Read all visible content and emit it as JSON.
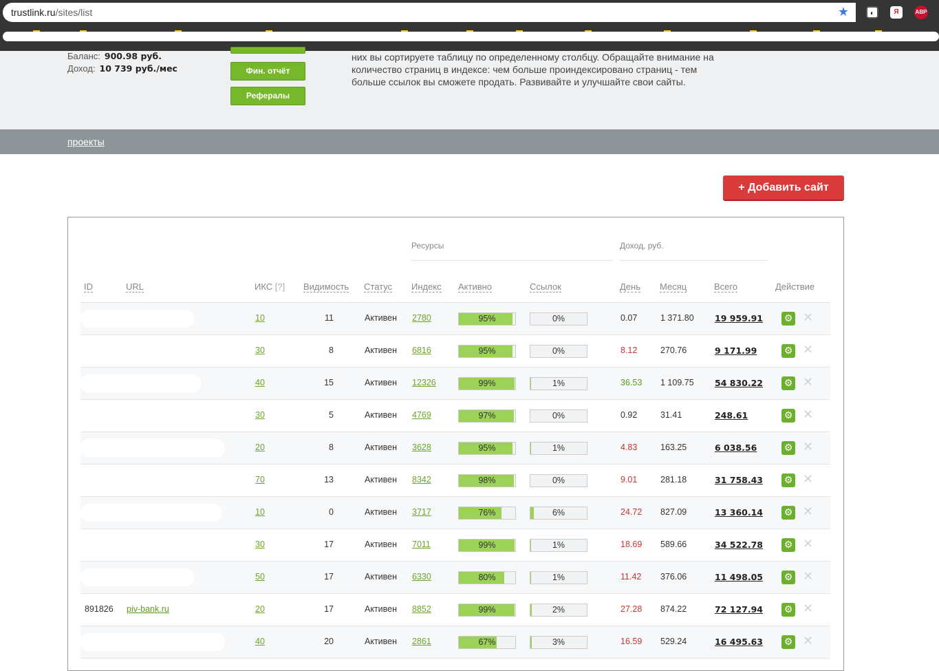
{
  "browser": {
    "url_host": "trustlink.ru",
    "url_path": "/sites/list"
  },
  "account": {
    "balance_label": "Баланс:",
    "balance_value": "900.98  руб.",
    "income_label": "Доход:",
    "income_value": "10 739 руб./мес"
  },
  "buttons": {
    "fin_report": "Фин. отчёт",
    "referrals": "Рефералы",
    "add_site": "+ Добавить сайт"
  },
  "info_text": "них вы сортируете таблицу по определенному столбцу. Обращайте внимание на количество страниц в индексе: чем больше проиндексировано страниц - тем больше ссылок вы сможете продать. Развивайте и улучшайте свои сайты.",
  "nav": {
    "projects": "проекты"
  },
  "table": {
    "group_resources": "Ресурсы",
    "group_income": "Доход,  руб.",
    "headers": {
      "id": "ID",
      "url": "URL",
      "iks": "ИКС",
      "iks_q": "[?]",
      "visibility": "Видимость",
      "status": "Статус",
      "index": "Индекс",
      "active": "Активно",
      "links": "Ссылок",
      "day": "День",
      "month": "Месяц",
      "total": "Всего",
      "action": "Действие"
    },
    "rows": [
      {
        "id": "",
        "url": "",
        "iks": "10",
        "vis": "11",
        "status": "Активен",
        "index": "2780",
        "active": 95,
        "active_lbl": "95%",
        "links": 0,
        "links_lbl": "0%",
        "day": "0.07",
        "day_color": "normal",
        "month": "1 371.80",
        "total": "19 959.91"
      },
      {
        "id": "",
        "url": "",
        "iks": "30",
        "vis": "8",
        "status": "Активен",
        "index": "6816",
        "active": 95,
        "active_lbl": "95%",
        "links": 0,
        "links_lbl": "0%",
        "day": "8.12",
        "day_color": "red",
        "month": "270.76",
        "total": "9 171.99"
      },
      {
        "id": "",
        "url": "",
        "iks": "40",
        "vis": "15",
        "status": "Активен",
        "index": "12326",
        "active": 99,
        "active_lbl": "99%",
        "links": 1,
        "links_lbl": "1%",
        "day": "36.53",
        "day_color": "green",
        "month": "1 109.75",
        "total": "54 830.22"
      },
      {
        "id": "",
        "url": "",
        "iks": "30",
        "vis": "5",
        "status": "Активен",
        "index": "4769",
        "active": 97,
        "active_lbl": "97%",
        "links": 0,
        "links_lbl": "0%",
        "day": "0.92",
        "day_color": "normal",
        "month": "31.41",
        "total": "248.61"
      },
      {
        "id": "",
        "url": "",
        "iks": "20",
        "vis": "8",
        "status": "Активен",
        "index": "3628",
        "active": 95,
        "active_lbl": "95%",
        "links": 1,
        "links_lbl": "1%",
        "day": "4.83",
        "day_color": "red",
        "month": "163.25",
        "total": "6 038.56"
      },
      {
        "id": "",
        "url": "",
        "iks": "70",
        "vis": "13",
        "status": "Активен",
        "index": "8342",
        "active": 98,
        "active_lbl": "98%",
        "links": 0,
        "links_lbl": "0%",
        "day": "9.01",
        "day_color": "red",
        "month": "281.18",
        "total": "31 758.43"
      },
      {
        "id": "",
        "url": "",
        "iks": "10",
        "vis": "0",
        "status": "Активен",
        "index": "3717",
        "active": 76,
        "active_lbl": "76%",
        "links": 6,
        "links_lbl": "6%",
        "day": "24.72",
        "day_color": "red",
        "month": "827.09",
        "total": "13 360.14"
      },
      {
        "id": "",
        "url": "",
        "iks": "30",
        "vis": "17",
        "status": "Активен",
        "index": "7011",
        "active": 99,
        "active_lbl": "99%",
        "links": 1,
        "links_lbl": "1%",
        "day": "18.69",
        "day_color": "red",
        "month": "589.66",
        "total": "34 522.78"
      },
      {
        "id": "",
        "url": "",
        "iks": "50",
        "vis": "17",
        "status": "Активен",
        "index": "6330",
        "active": 80,
        "active_lbl": "80%",
        "links": 1,
        "links_lbl": "1%",
        "day": "11.42",
        "day_color": "red",
        "month": "376.06",
        "total": "11 498.05"
      },
      {
        "id": "891826",
        "url": "piv-bank.ru",
        "iks": "20",
        "vis": "17",
        "status": "Активен",
        "index": "8852",
        "active": 99,
        "active_lbl": "99%",
        "links": 2,
        "links_lbl": "2%",
        "day": "27.28",
        "day_color": "red",
        "month": "874.22",
        "total": "72 127.94"
      },
      {
        "id": "",
        "url": "",
        "iks": "40",
        "vis": "20",
        "status": "Активен",
        "index": "2861",
        "active": 67,
        "active_lbl": "67%",
        "links": 3,
        "links_lbl": "3%",
        "day": "16.59",
        "day_color": "red",
        "month": "529.24",
        "total": "16 495.63"
      }
    ]
  },
  "icons": {
    "star": "star-icon",
    "settings": "gear-icon",
    "delete": "close-icon"
  },
  "colors": {
    "green_button": "#77b82a",
    "red_button": "#d93a3a",
    "nav_gray": "#8d9599",
    "bar_fill": "#9bd257"
  }
}
